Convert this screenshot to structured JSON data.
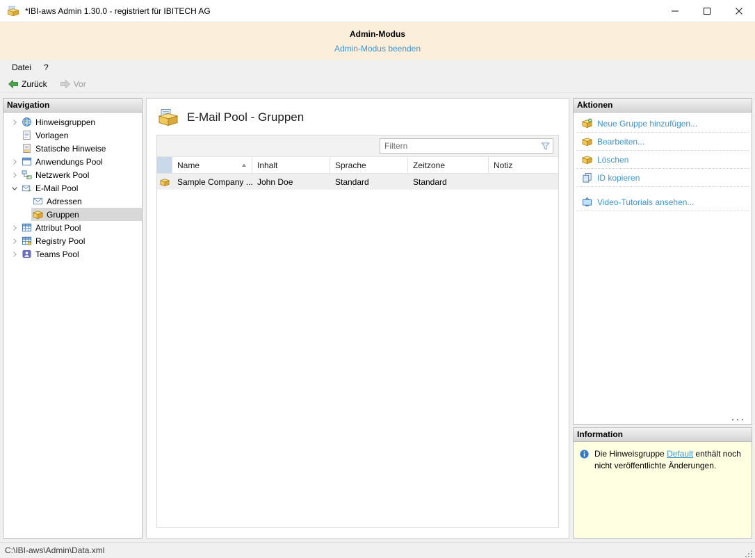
{
  "window": {
    "title": "*IBI-aws Admin 1.30.0 - registriert für IBITECH AG",
    "controls": [
      "minimize",
      "maximize",
      "close"
    ]
  },
  "admin_banner": {
    "title": "Admin-Modus",
    "link_label": "Admin-Modus beenden"
  },
  "menubar": {
    "items": [
      {
        "label": "Datei"
      },
      {
        "label": "?"
      }
    ]
  },
  "toolbar": {
    "back_label": "Zurück",
    "forward_label": "Vor"
  },
  "navigation": {
    "header": "Navigation",
    "items": [
      {
        "label": "Hinweisgruppen",
        "icon": "notice-groups-icon",
        "expandable": true
      },
      {
        "label": "Vorlagen",
        "icon": "templates-icon"
      },
      {
        "label": "Statische Hinweise",
        "icon": "static-notices-icon"
      },
      {
        "label": "Anwendungs Pool",
        "icon": "application-pool-icon",
        "expandable": true
      },
      {
        "label": "Netzwerk Pool",
        "icon": "network-pool-icon",
        "expandable": true
      },
      {
        "label": "E-Mail Pool",
        "icon": "email-pool-icon",
        "expandable": true,
        "expanded": true
      },
      {
        "label": "Adressen",
        "icon": "addresses-icon",
        "child": true
      },
      {
        "label": "Gruppen",
        "icon": "groups-icon",
        "child": true,
        "selected": true
      },
      {
        "label": "Attribut Pool",
        "icon": "attribute-pool-icon",
        "expandable": true
      },
      {
        "label": "Registry Pool",
        "icon": "registry-pool-icon",
        "expandable": true
      },
      {
        "label": "Teams Pool",
        "icon": "teams-pool-icon",
        "expandable": true
      }
    ]
  },
  "content": {
    "title": "E-Mail Pool - Gruppen",
    "title_icon": "email-group-icon",
    "filter": {
      "placeholder": "Filtern",
      "value": ""
    },
    "table": {
      "columns": [
        "Name",
        "Inhalt",
        "Sprache",
        "Zeitzone",
        "Notiz"
      ],
      "sort": {
        "column": "Name",
        "direction": "ascending"
      },
      "rows": [
        {
          "icon": "groups-icon",
          "name": "Sample Company ...",
          "inhalt": "John Doe",
          "sprache": "Standard",
          "zeitzone": "Standard",
          "notiz": ""
        }
      ]
    }
  },
  "actions": {
    "header": "Aktionen",
    "items": [
      {
        "label": "Neue Gruppe hinzufügen...",
        "icon": "package-add-icon"
      },
      {
        "label": "Bearbeiten...",
        "icon": "package-edit-icon"
      },
      {
        "label": "Löschen",
        "icon": "package-delete-icon"
      },
      {
        "label": "ID kopieren",
        "icon": "copy-icon"
      },
      {
        "label": "Video-Tutorials ansehen...",
        "icon": "tv-icon"
      }
    ]
  },
  "information": {
    "header": "Information",
    "icon": "info-icon",
    "text_before": "Die Hinweisgruppe ",
    "link_label": "Default",
    "text_after": " enthält noch nicht veröffentlichte Änderungen."
  },
  "statusbar": {
    "path": "C:\\IBI-aws\\Admin\\Data.xml"
  }
}
